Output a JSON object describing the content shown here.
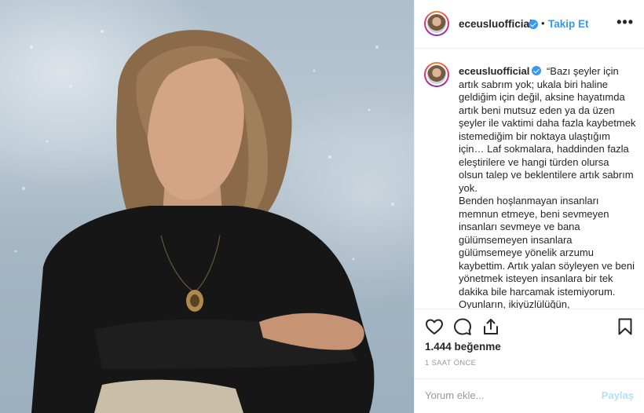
{
  "post": {
    "username": "eceusluofficial",
    "follow_label": "Takip Et",
    "separator": "•",
    "more_label": "•••",
    "caption_lines": "“Bazı şeyler için artık sabrım yok; ukala biri haline geldiğim için değil, aksine hayatımda artık beni mutsuz eden ya da üzen şeyler ile vaktimi daha fazla kaybetmek istemediğim bir noktaya ulaştığım için… Laf sokmalara, haddinden fazla eleştirilere ve hangi türden olursa olsun talep ve beklentilere artık sabrım yok.\n Benden hoşlanmayan insanları memnun etmeye, beni sevmeyen insanları sevmeye ve bana gülümsemeyen insanlara gülümsemeye yönelik arzumu kaybettim. Artık yalan söyleyen ve beni yönetmek isteyen insanlara bir tek dakika bile harcamak istemiyorum. Oyunların, ikiyüzlülüğün, sahtekarlıkların ve ucuz övgülerin olduğu ortamlarda bulunmak istemiyorum. Çok bilmişliğe ve",
    "likes": "1.444 beğenme",
    "timestamp": "1 SAAT ÖNCE",
    "comment_placeholder": "Yorum ekle...",
    "post_button": "Paylaş"
  },
  "icons": {
    "verified": "verified-badge-icon",
    "like": "heart-icon",
    "comment": "comment-bubble-icon",
    "share": "share-upload-icon",
    "save": "bookmark-icon"
  },
  "colors": {
    "accent": "#3897f0",
    "post_disabled": "#b2dffc",
    "muted": "#999999",
    "border": "#efefef"
  }
}
